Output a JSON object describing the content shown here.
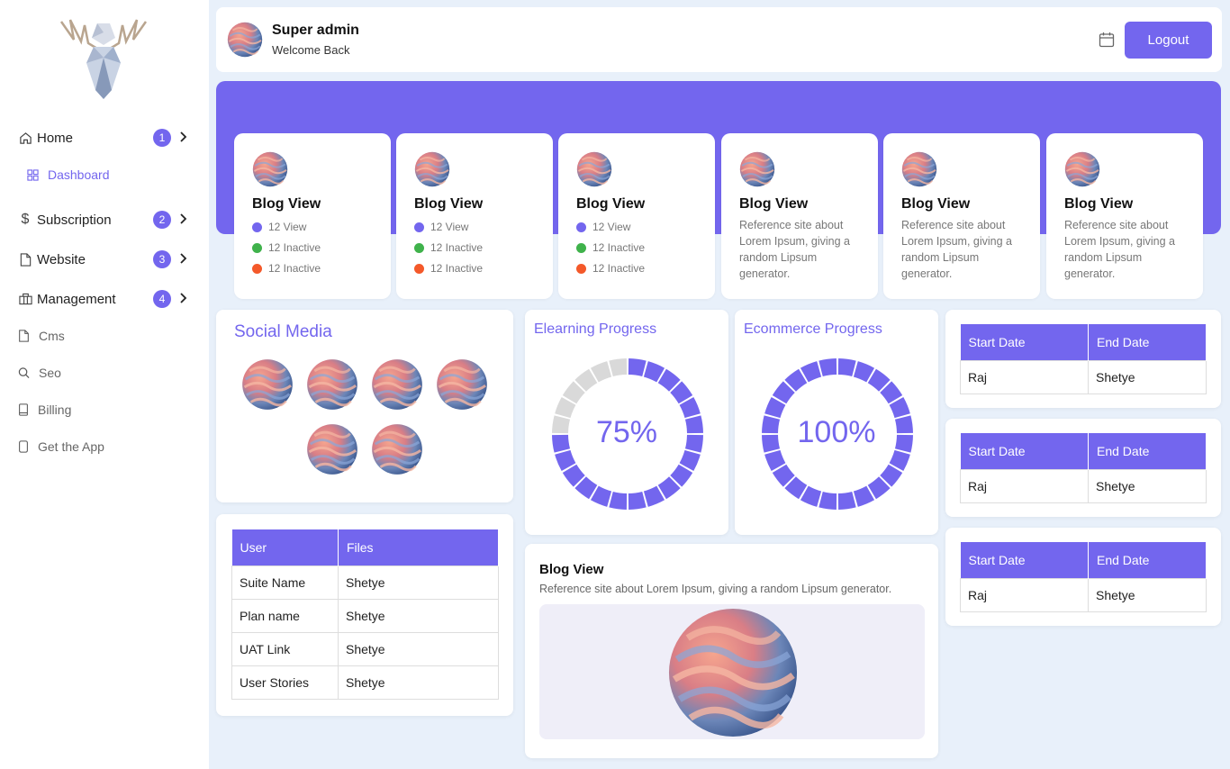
{
  "sidebar": {
    "home": {
      "label": "Home",
      "badge": "1"
    },
    "dashboard": {
      "label": "Dashboard"
    },
    "subscription": {
      "label": "Subscription",
      "badge": "2"
    },
    "website": {
      "label": "Website",
      "badge": "3"
    },
    "management": {
      "label": "Management",
      "badge": "4"
    },
    "cms": {
      "label": "Cms"
    },
    "seo": {
      "label": "Seo"
    },
    "billing": {
      "label": "Billing"
    },
    "get_app": {
      "label": "Get the App"
    }
  },
  "header": {
    "name": "Super admin",
    "welcome": "Welcome Back",
    "logout_label": "Logout"
  },
  "cards": [
    {
      "title": "Blog View",
      "stats": [
        "12 View",
        "12 Inactive",
        "12 Inactive"
      ]
    },
    {
      "title": "Blog View",
      "stats": [
        "12 View",
        "12 Inactive",
        "12 Inactive"
      ]
    },
    {
      "title": "Blog View",
      "stats": [
        "12 View",
        "12 Inactive",
        "12 Inactive"
      ]
    },
    {
      "title": "Blog View",
      "desc": "Reference site about Lorem Ipsum, giving a random Lipsum generator."
    },
    {
      "title": "Blog View",
      "desc": "Reference site about Lorem Ipsum, giving a random Lipsum generator."
    },
    {
      "title": "Blog View",
      "desc": "Reference site about Lorem Ipsum, giving a random Lipsum generator."
    }
  ],
  "social": {
    "title": "Social Media"
  },
  "elearning": {
    "title": "Elearning Progress",
    "value": "75%",
    "fraction": 0.75
  },
  "ecommerce": {
    "title": "Ecommerce Progress",
    "value": "100%",
    "fraction": 1.0
  },
  "user_table": {
    "headers": [
      "User",
      "Files"
    ],
    "rows": [
      [
        "Suite Name",
        "Shetye"
      ],
      [
        "Plan name",
        "Shetye"
      ],
      [
        "UAT Link",
        "Shetye"
      ],
      [
        "User Stories",
        "Shetye"
      ]
    ]
  },
  "blog": {
    "title": "Blog View",
    "desc": "Reference site about Lorem Ipsum, giving a random Lipsum generator."
  },
  "date_tables": [
    {
      "headers": [
        "Start Date",
        "End Date"
      ],
      "row": [
        "Raj",
        "Shetye"
      ]
    },
    {
      "headers": [
        "Start Date",
        "End Date"
      ],
      "row": [
        "Raj",
        "Shetye"
      ]
    },
    {
      "headers": [
        "Start Date",
        "End Date"
      ],
      "row": [
        "Raj",
        "Shetye"
      ]
    }
  ],
  "colors": {
    "accent": "#7366ee",
    "view_dot": "#7366ee",
    "inactive_green": "#3fb24b",
    "inactive_orange": "#f4592a",
    "donut_empty": "#d9d9d9"
  }
}
